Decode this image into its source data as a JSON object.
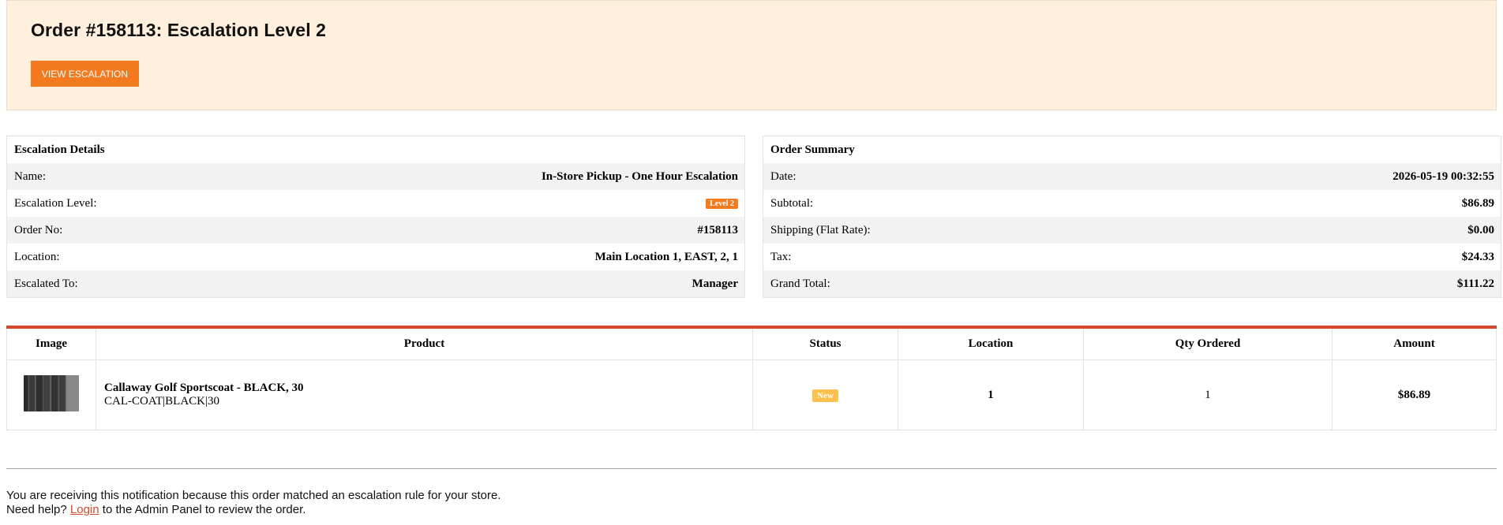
{
  "header": {
    "title": "Order #158113: Escalation Level 2",
    "button_label": "VIEW ESCALATION"
  },
  "escalation_details": {
    "title": "Escalation Details",
    "rows": [
      {
        "label": "Name:",
        "value": "In-Store Pickup - One Hour Escalation"
      },
      {
        "label": "Escalation Level:",
        "value": "Level 2"
      },
      {
        "label": "Order No:",
        "value": "#158113"
      },
      {
        "label": "Location:",
        "value": "Main Location 1, EAST, 2, 1"
      },
      {
        "label": "Escalated To:",
        "value": "Manager"
      }
    ]
  },
  "order_summary": {
    "title": "Order Summary",
    "rows": [
      {
        "label": "Date:",
        "value": "2026-05-19 00:32:55"
      },
      {
        "label": "Subtotal:",
        "value": "$86.89"
      },
      {
        "label": "Shipping (Flat Rate):",
        "value": "$0.00"
      },
      {
        "label": "Tax:",
        "value": "$24.33"
      },
      {
        "label": "Grand Total:",
        "value": "$111.22"
      }
    ]
  },
  "products": {
    "columns": [
      "Image",
      "Product",
      "Status",
      "Location",
      "Qty Ordered",
      "Amount"
    ],
    "items": [
      {
        "image_icon": "sportscoat-thumbnail",
        "name": "Callaway Golf Sportscoat - BLACK, 30",
        "sku": "CAL-COAT|BLACK|30",
        "status": "New",
        "location": "1",
        "qty": "1",
        "amount": "$86.89"
      }
    ]
  },
  "footer": {
    "line1": "You are receiving this notification because this order matched an escalation rule for your store.",
    "line2_prefix": "Need help?",
    "link": "Login",
    "line2_suffix": "to the Admin Panel to review the order."
  },
  "colors": {
    "accent": "#f47a20",
    "header_bg": "#fff0dd",
    "table_rule": "#d64a2a",
    "badge_new": "#ffc04d"
  }
}
